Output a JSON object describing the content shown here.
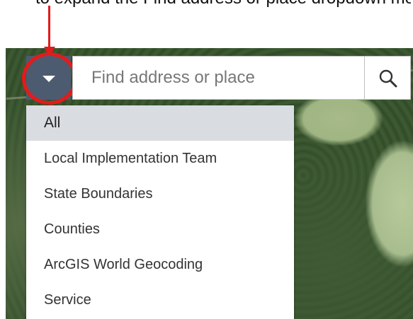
{
  "annotation": {
    "top_text": "to expand the Find address or place dropdown menu, click the arrow to the left of it.",
    "arrow_color": "#e31b1b",
    "circle_color": "#e31b1b"
  },
  "search": {
    "placeholder": "Find address or place",
    "value": "",
    "toggle_icon": "caret-down-icon",
    "search_icon": "magnifier-icon",
    "toggle_color": "#4d5b70"
  },
  "menu": {
    "items": [
      {
        "label": "All",
        "selected": true
      },
      {
        "label": "Local Implementation Team",
        "selected": false
      },
      {
        "label": "State Boundaries",
        "selected": false
      },
      {
        "label": "Counties",
        "selected": false
      },
      {
        "label": "ArcGIS World Geocoding",
        "selected": false
      },
      {
        "label": "Service",
        "selected": false
      }
    ]
  }
}
